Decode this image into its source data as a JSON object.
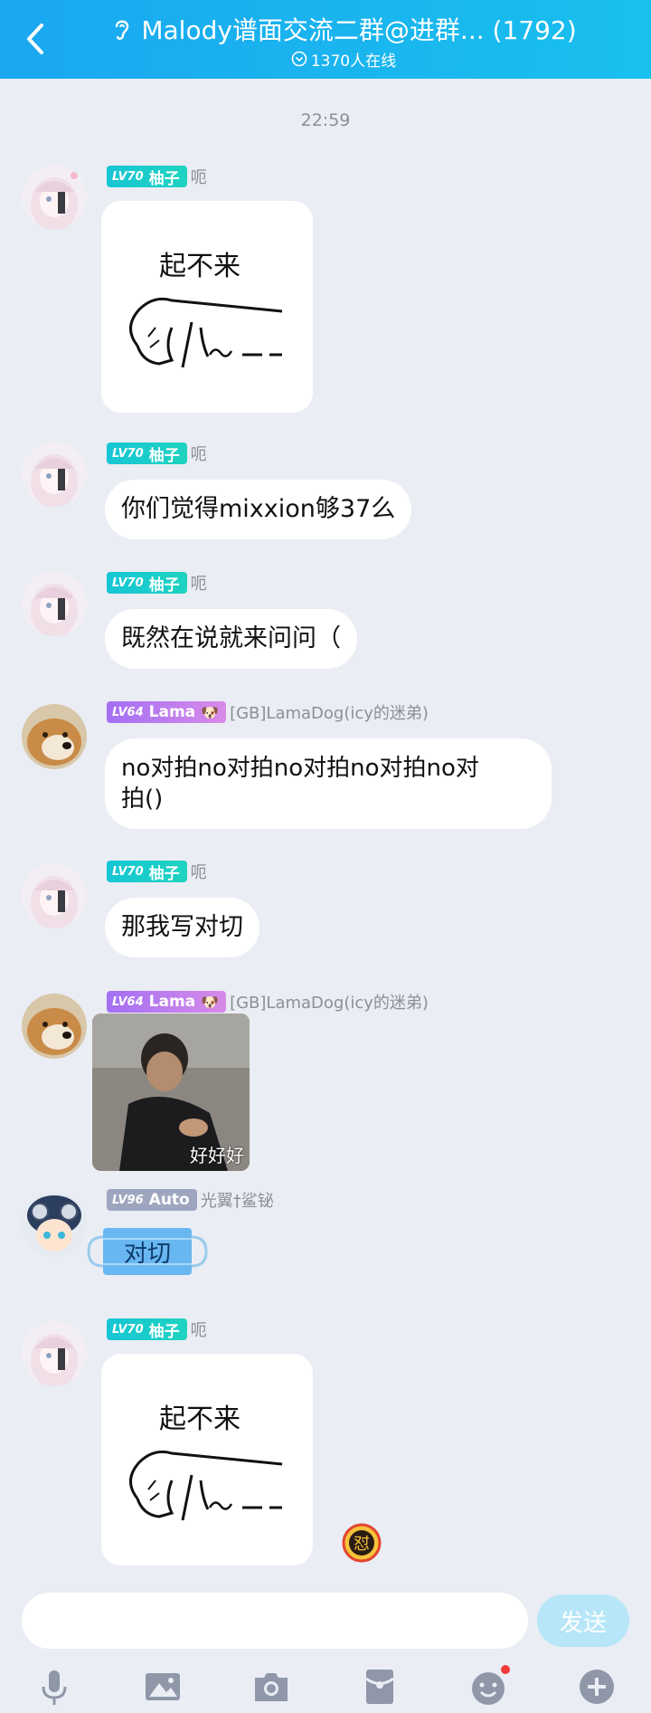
{
  "header": {
    "title": "Malody谱面交流二群@进群... (1792)",
    "online": "1370人在线",
    "back_icon": "chevron-left-icon",
    "ear_icon": "ear-icon"
  },
  "timestamp": "22:59",
  "messages": [
    {
      "badge_lv": "LV70",
      "badge_name": "柚子",
      "nickname": "呃",
      "type": "sticker"
    },
    {
      "badge_lv": "LV70",
      "badge_name": "柚子",
      "nickname": "呃",
      "text": "你们觉得mixxion够37么"
    },
    {
      "badge_lv": "LV70",
      "badge_name": "柚子",
      "nickname": "呃",
      "text": "既然在说就来问问（"
    },
    {
      "badge_lv": "LV64",
      "badge_name": "Lama",
      "nickname": "[GB]LamaDog(icy的迷弟)",
      "text_line1": "no对拍no对拍no对拍no对拍no对",
      "text_line2": "拍()"
    },
    {
      "badge_lv": "LV70",
      "badge_name": "柚子",
      "nickname": "呃",
      "text": "那我写对切"
    },
    {
      "badge_lv": "LV64",
      "badge_name": "Lama",
      "nickname": "[GB]LamaDog(icy的迷弟)",
      "caption": "好好好"
    },
    {
      "badge_lv": "LV96",
      "badge_name": "Auto",
      "nickname": "光翼†鲨铋",
      "sticker_text": "对切"
    },
    {
      "badge_lv": "LV70",
      "badge_name": "柚子",
      "nickname": "呃",
      "type": "sticker"
    }
  ],
  "sticker": {
    "line": "起不来"
  },
  "float_badge": "怼",
  "input": {
    "placeholder": "",
    "send_label": "发送"
  },
  "toolbar": [
    "microphone-icon",
    "image-icon",
    "camera-icon",
    "red-packet-icon",
    "emoji-icon",
    "plus-icon"
  ],
  "colors": {
    "header": "#1aa7f0",
    "background": "#eaedf4",
    "badge_cyan": "#16c6d5",
    "badge_purple": "#a36ff4",
    "badge_gray": "#9ea6bf",
    "send_button": "#b6e6f8"
  }
}
